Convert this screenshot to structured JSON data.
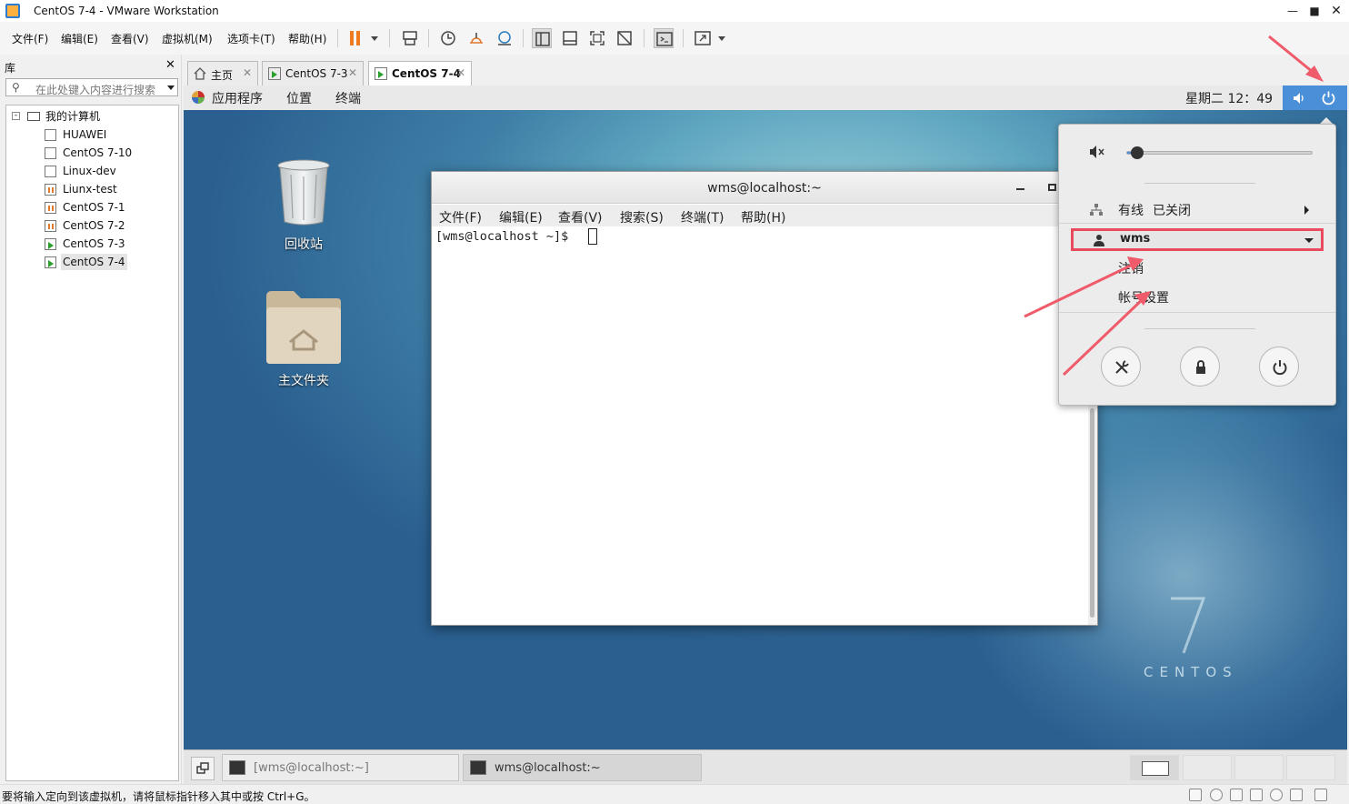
{
  "window": {
    "title": "CentOS 7-4 - VMware Workstation",
    "minimize_icon": "minimize-icon",
    "maximize_icon": "maximize-icon",
    "close_icon": "close-icon"
  },
  "menubar": {
    "items": [
      "文件(F)",
      "编辑(E)",
      "查看(V)",
      "虚拟机(M)",
      "选项卡(T)",
      "帮助(H)"
    ]
  },
  "toolbar": {
    "icons": [
      "pause-icon",
      "send-ctrl-alt-del-icon",
      "snapshot-icon",
      "revert-snapshot-icon",
      "snapshot-manager-icon",
      "library-view-icon",
      "thumbnail-view-icon",
      "fullscreen-icon",
      "unity-icon",
      "console-icon",
      "stretch-icon"
    ],
    "accent": "#f07b1e"
  },
  "library": {
    "title": "库",
    "search_placeholder": "在此处键入内容进行搜索",
    "root": "我的计算机",
    "vms": [
      {
        "name": "HUAWEI",
        "running": false
      },
      {
        "name": "CentOS 7-10",
        "running": false
      },
      {
        "name": "Linux-dev",
        "running": false
      },
      {
        "name": "Liunx-test",
        "running": false
      },
      {
        "name": "CentOS 7-1",
        "running": false
      },
      {
        "name": "CentOS 7-2",
        "running": false
      },
      {
        "name": "CentOS 7-3",
        "running": true
      },
      {
        "name": "CentOS 7-4",
        "running": true,
        "selected": true
      }
    ]
  },
  "tabs": [
    {
      "label": "主页",
      "active": false
    },
    {
      "label": "CentOS 7-3",
      "active": false
    },
    {
      "label": "CentOS 7-4",
      "active": true
    }
  ],
  "gnome": {
    "top_menu": [
      "应用程序",
      "位置",
      "终端"
    ],
    "clock": "星期二 12：49",
    "desktop_icons": [
      "回收站",
      "主文件夹"
    ],
    "brand_number": "7",
    "brand_text": "CENTOS",
    "indicator_color": "#4a90d9"
  },
  "terminal": {
    "title": "wms@localhost:~",
    "menu": [
      "文件(F)",
      "编辑(E)",
      "查看(V)",
      "搜索(S)",
      "终端(T)",
      "帮助(H)"
    ],
    "prompt": "[wms@localhost ~]$ "
  },
  "system_menu": {
    "volume_level": 0.06,
    "network_label": "有线",
    "network_status": "已关闭",
    "user": "wms",
    "user_items": [
      "注销",
      "帐号设置"
    ],
    "actions": [
      "settings-icon",
      "lock-icon",
      "power-icon"
    ],
    "highlight_color": "#e94a5e"
  },
  "vm_taskbar": {
    "windows": [
      "[wms@localhost:~]",
      "wms@localhost:~"
    ]
  },
  "statusbar": {
    "text": "要将输入定向到该虚拟机，请将鼠标指针移入其中或按 Ctrl+G。"
  }
}
